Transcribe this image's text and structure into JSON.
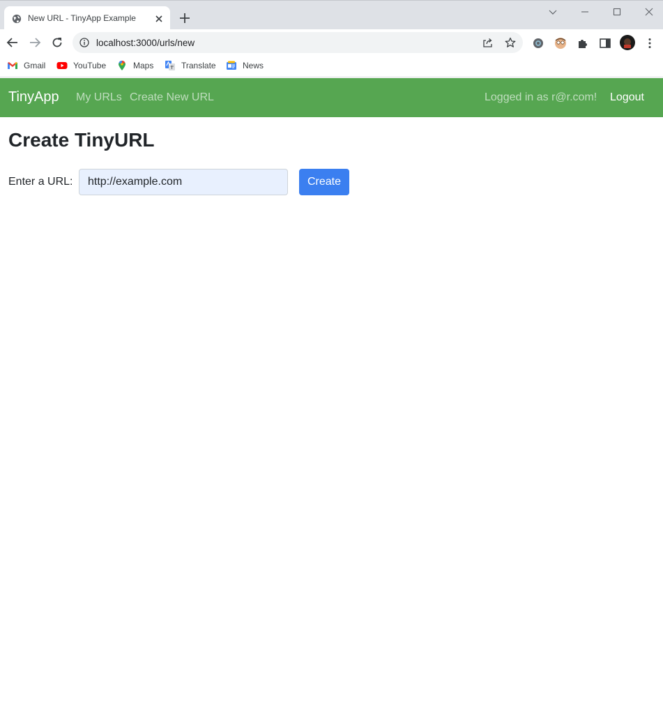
{
  "browser": {
    "tab_title": "New URL - TinyApp Example",
    "url": "localhost:3000/urls/new",
    "bookmarks": [
      {
        "label": "Gmail",
        "icon": "gmail-icon"
      },
      {
        "label": "YouTube",
        "icon": "youtube-icon"
      },
      {
        "label": "Maps",
        "icon": "maps-icon"
      },
      {
        "label": "Translate",
        "icon": "translate-icon"
      },
      {
        "label": "News",
        "icon": "news-icon"
      }
    ]
  },
  "navbar": {
    "brand": "TinyApp",
    "links": [
      "My URLs",
      "Create New URL"
    ],
    "logged_in_text": "Logged in as r@r.com!",
    "logout_label": "Logout",
    "color": "#56a651"
  },
  "main": {
    "title": "Create TinyURL",
    "input_label": "Enter a URL:",
    "input_value": "http://example.com",
    "create_label": "Create",
    "button_color": "#3b7ff0"
  }
}
